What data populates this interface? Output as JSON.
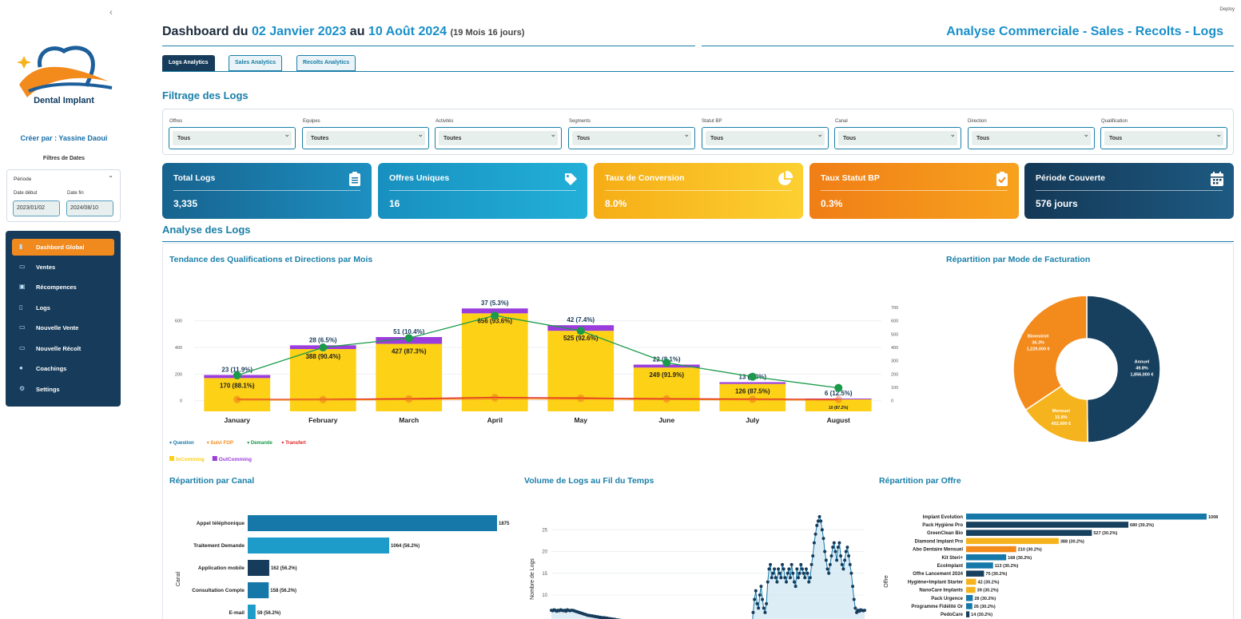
{
  "app": {
    "deploy_label": "Deploy"
  },
  "sidebar": {
    "brand_name": "Dental Implant",
    "creator": "Créer par : Yassine Daoui",
    "date_filters_title": "Filtres de Dates",
    "period_label": "Période",
    "start_label": "Date début",
    "end_label": "Date fin",
    "start_value": "2023/01/02",
    "end_value": "2024/08/10",
    "nav_items": [
      {
        "label": "Dashbord Global",
        "icon": "bar-chart-icon",
        "active": true
      },
      {
        "label": "Ventes",
        "icon": "card-icon"
      },
      {
        "label": "Récompences",
        "icon": "box-icon"
      },
      {
        "label": "Logs",
        "icon": "document-icon"
      },
      {
        "label": "Nouvelle Vente",
        "icon": "card-icon"
      },
      {
        "label": "Nouvelle Récolt",
        "icon": "card-icon"
      },
      {
        "label": "Coachings",
        "icon": "users-icon"
      },
      {
        "label": "Settings",
        "icon": "gear-icon"
      }
    ]
  },
  "header": {
    "title_prefix": "Dashboard du",
    "start_date": "02 Janvier 2023",
    "connector": "au",
    "end_date": "10 Août 2024",
    "duration": "(19 Mois 16 jours)",
    "right_title": "Analyse Commerciale - Sales - Recolts - Logs"
  },
  "tabs": [
    {
      "label": "Logs Analytics",
      "active": true
    },
    {
      "label": "Sales Analytics",
      "active": false
    },
    {
      "label": "Recolts Analytics",
      "active": false
    }
  ],
  "filters": {
    "title": "Filtrage des Logs",
    "items": [
      {
        "label": "Offres",
        "value": "Tous"
      },
      {
        "label": "Equipes",
        "value": "Toutes"
      },
      {
        "label": "Activités",
        "value": "Toutes"
      },
      {
        "label": "Segments",
        "value": "Tous"
      },
      {
        "label": "Statut BP",
        "value": "Tous"
      },
      {
        "label": "Canal",
        "value": "Tous"
      },
      {
        "label": "Direction",
        "value": "Tous"
      },
      {
        "label": "Qualification",
        "value": "Tous"
      }
    ]
  },
  "kpis": [
    {
      "label": "Total Logs",
      "value": "3,335",
      "icon": "clipboard-list-icon",
      "color": "#1a78ad"
    },
    {
      "label": "Offres Uniques",
      "value": "16",
      "icon": "tag-icon",
      "color": "#1d9bc9"
    },
    {
      "label": "Taux de Conversion",
      "value": "8.0%",
      "icon": "pie-chart-icon",
      "color": "#f5b41d"
    },
    {
      "label": "Taux Statut BP",
      "value": "0.3%",
      "icon": "clipboard-check-icon",
      "color": "#f28a1c"
    },
    {
      "label": "Période Couverte",
      "value": "576 jours",
      "icon": "calendar-icon",
      "color": "#17405f"
    }
  ],
  "analysis_title": "Analyse des Logs",
  "charts": {
    "trend_title": "Tendance des Qualifications et Directions par Mois",
    "billing_title": "Répartition par Mode de Facturation",
    "canal_title": "Répartition par Canal",
    "volume_title": "Volume de Logs au Fil du Temps",
    "offer_title": "Répartition par Offre",
    "legend_lines": [
      "Question",
      "Suivi FOP",
      "Demande",
      "Transfert"
    ],
    "legend_bars": [
      "InComming",
      "OutComming"
    ],
    "canal_axis": "Canal",
    "volume_axis": "Nombre de Logs",
    "offer_axis": "Offre"
  },
  "chart_data": [
    {
      "type": "bar",
      "title": "Tendance des Qualifications et Directions par Mois",
      "categories": [
        "January",
        "February",
        "March",
        "April",
        "May",
        "June",
        "July",
        "August"
      ],
      "ylim": [
        -80,
        700
      ],
      "y2lim": [
        -80,
        700
      ],
      "yticks": [
        0,
        200,
        400,
        600
      ],
      "y2ticks": [
        0,
        100,
        200,
        300,
        400,
        500,
        600,
        700
      ],
      "series": [
        {
          "name": "InComming",
          "values": [
            170,
            388,
            427,
            656,
            525,
            249,
            126,
            10
          ],
          "labels": [
            "170 (88.1%)",
            "388 (90.4%)",
            "427 (87.3%)",
            "656 (93.6%)",
            "525 (92.6%)",
            "249 (91.9%)",
            "126 (87.5%)",
            "10 (87.2%)"
          ],
          "color": "#fcd116"
        },
        {
          "name": "OutComming",
          "values": [
            23,
            28,
            51,
            37,
            42,
            22,
            13,
            6
          ],
          "labels": [
            "23 (11.9%)",
            "28 (6.5%)",
            "51 (10.4%)",
            "37 (5.3%)",
            "42 (7.4%)",
            "22 (8.1%)",
            "13 (9.0%)",
            "6 (12.5%)"
          ],
          "color": "#9b3ddc"
        },
        {
          "name": "Demande",
          "type": "line",
          "values": [
            190,
            400,
            470,
            640,
            525,
            285,
            180,
            96
          ],
          "color": "#1a9a4a"
        },
        {
          "name": "Transfert",
          "type": "line",
          "values": [
            10,
            10,
            15,
            25,
            20,
            15,
            12,
            10
          ],
          "color": "#e02424"
        },
        {
          "name": "Suivi FOP",
          "type": "line",
          "values": [
            5,
            5,
            8,
            14,
            12,
            8,
            6,
            4
          ],
          "color": "#f28a1c"
        }
      ]
    },
    {
      "type": "pie",
      "title": "Répartition par Mode de Facturation",
      "slices": [
        {
          "name": "Annuel",
          "percent": "49.8%",
          "amount": "1,856,000 €",
          "value": 49.8,
          "color": "#17405f"
        },
        {
          "name": "Mensuel",
          "percent": "15.8%",
          "amount": "452,000 €",
          "value": 15.8,
          "color": "#f5b41d"
        },
        {
          "name": "Bimestriel",
          "percent": "36.3%",
          "amount": "1,229,000 €",
          "value": 34.4,
          "color": "#f28a1c"
        }
      ]
    },
    {
      "type": "bar",
      "orientation": "horizontal",
      "title": "Répartition par Canal",
      "ylabel": "Canal",
      "categories": [
        "Appel téléphonique",
        "Traitement Demande",
        "Application mobile",
        "Consultation Compte",
        "E-mail"
      ],
      "values": [
        1875,
        1064,
        162,
        158,
        59
      ],
      "labels": [
        "1875",
        "1064 (56.2%)",
        "162 (56.2%)",
        "158 (56.2%)",
        "59 (56.2%)"
      ],
      "colors": [
        "#1578a8",
        "#1d9bc9",
        "#173c5b",
        "#1578a8",
        "#1d9bc9"
      ]
    },
    {
      "type": "line",
      "title": "Volume de Logs au Fil du Temps",
      "ylabel": "Nombre de Logs",
      "yticks": [
        10,
        15,
        20,
        25
      ],
      "y": [
        6.5,
        6.4,
        6.6,
        6.5,
        6.3,
        6.5,
        6.4,
        6.6,
        6.5,
        6.4,
        6.5,
        6.3,
        6.6,
        6.5,
        6.4,
        6.5,
        6.5,
        6.4,
        6.3,
        6.2,
        6.1,
        6.0,
        5.9,
        5.8,
        5.7,
        5.6,
        5.5,
        5.4,
        5.3,
        5.3,
        5.2,
        5.2,
        5.1,
        5.1,
        5.0,
        5.0,
        4.9,
        4.9,
        4.8,
        4.8,
        4.8,
        4.7,
        4.7,
        4.6,
        4.6,
        4.5,
        4.5,
        4.4,
        4.4,
        4.3,
        4.3,
        4.2,
        4.2,
        4.1,
        4.1,
        4.0,
        4.0,
        3.9,
        3.9,
        3.8,
        3.8,
        3.7,
        3.7,
        3.6,
        3.6,
        3.5,
        3.5,
        3.4,
        3.4,
        3.3,
        3.3,
        3.2,
        3.2,
        3.1,
        3.1,
        3.0,
        3.0,
        2.9,
        2.9,
        2.8,
        2.8,
        2.7,
        2.7,
        2.6,
        2.6,
        2.5,
        2.5,
        2.4,
        2.4,
        2.3,
        2.3,
        2.2,
        2.2,
        2.1,
        2.1,
        2.0,
        2.0,
        2.0,
        2.0,
        2.0,
        2.0,
        2.0,
        2.0,
        2.0,
        2.0,
        2.0,
        2.0,
        2.0,
        2.0,
        2.0,
        2.0,
        2.0,
        2.0,
        2.0,
        2.0,
        2.0,
        2.0,
        2.0,
        2.0,
        2.0,
        2.0,
        2.0,
        2.0,
        2.0,
        2.0,
        2.0,
        2.0,
        2.0,
        2.0,
        2.0,
        2.0,
        2.0,
        2.0,
        2.0,
        2.0,
        2.0,
        2.0,
        2.0,
        2.0,
        2.0,
        2.0,
        2.0,
        2.0,
        2.0,
        2.0,
        2.0,
        2.0,
        2.0,
        2.0,
        2.0,
        2.0,
        2.0,
        6.0,
        9.0,
        11.0,
        8.0,
        7.0,
        10.0,
        12.0,
        9.0,
        7.0,
        6.0,
        8.0,
        13.0,
        16.0,
        17.0,
        14.0,
        15.0,
        16.0,
        14.0,
        13.0,
        16.0,
        15.0,
        14.0,
        17.0,
        16.0,
        14.0,
        13.0,
        15.0,
        16.0,
        14.0,
        17.0,
        15.0,
        13.0,
        12.0,
        16.0,
        14.0,
        15.0,
        17.0,
        16.0,
        15.0,
        14.0,
        16.0,
        15.0,
        13.0,
        14.0,
        17.0,
        19.0,
        22.0,
        24.0,
        26.0,
        27.0,
        28.0,
        27.0,
        25.0,
        23.0,
        20.0,
        18.0,
        16.0,
        15.0,
        17.0,
        19.0,
        21.0,
        22.0,
        20.0,
        18.0,
        21.0,
        22.0,
        19.0,
        17.0,
        16.0,
        18.0,
        20.0,
        21.0,
        19.0,
        17.0,
        15.0,
        12.0,
        9.0,
        7.0,
        6.0,
        6.5,
        6.3,
        6.6,
        6.5,
        6.4,
        6.5
      ]
    },
    {
      "type": "bar",
      "orientation": "horizontal",
      "title": "Répartition par Offre",
      "ylabel": "Offre",
      "categories": [
        "Implant Evolution",
        "Pack Hygiène Pro",
        "GreenClean Bio",
        "Diamond Implant Pro",
        "Abo Dentaire Mensuel",
        "Kit Steri+",
        "EcoImplant",
        "Offre Lancement 2024",
        "Hygiène+Implant Starter",
        "NanoCare Implants",
        "Pack Urgence",
        "Programme Fidélité Or",
        "PedoCare"
      ],
      "values": [
        1008,
        680,
        527,
        388,
        210,
        168,
        113,
        75,
        42,
        39,
        28,
        26,
        14
      ],
      "labels": [
        "1008",
        "680 (30.2%)",
        "527 (30.2%)",
        "388 (30.2%)",
        "210 (30.2%)",
        "168 (30.2%)",
        "113 (30.2%)",
        "75 (30.2%)",
        "42 (30.2%)",
        "39 (30.2%)",
        "28 (30.2%)",
        "26 (30.2%)",
        "14 (30.2%)"
      ],
      "colors": [
        "#1578a8",
        "#17405f",
        "#17405f",
        "#f5b41d",
        "#f28a1c",
        "#1578a8",
        "#1578a8",
        "#17405f",
        "#f5b41d",
        "#f5b41d",
        "#1578a8",
        "#1578a8",
        "#17405f"
      ]
    }
  ]
}
